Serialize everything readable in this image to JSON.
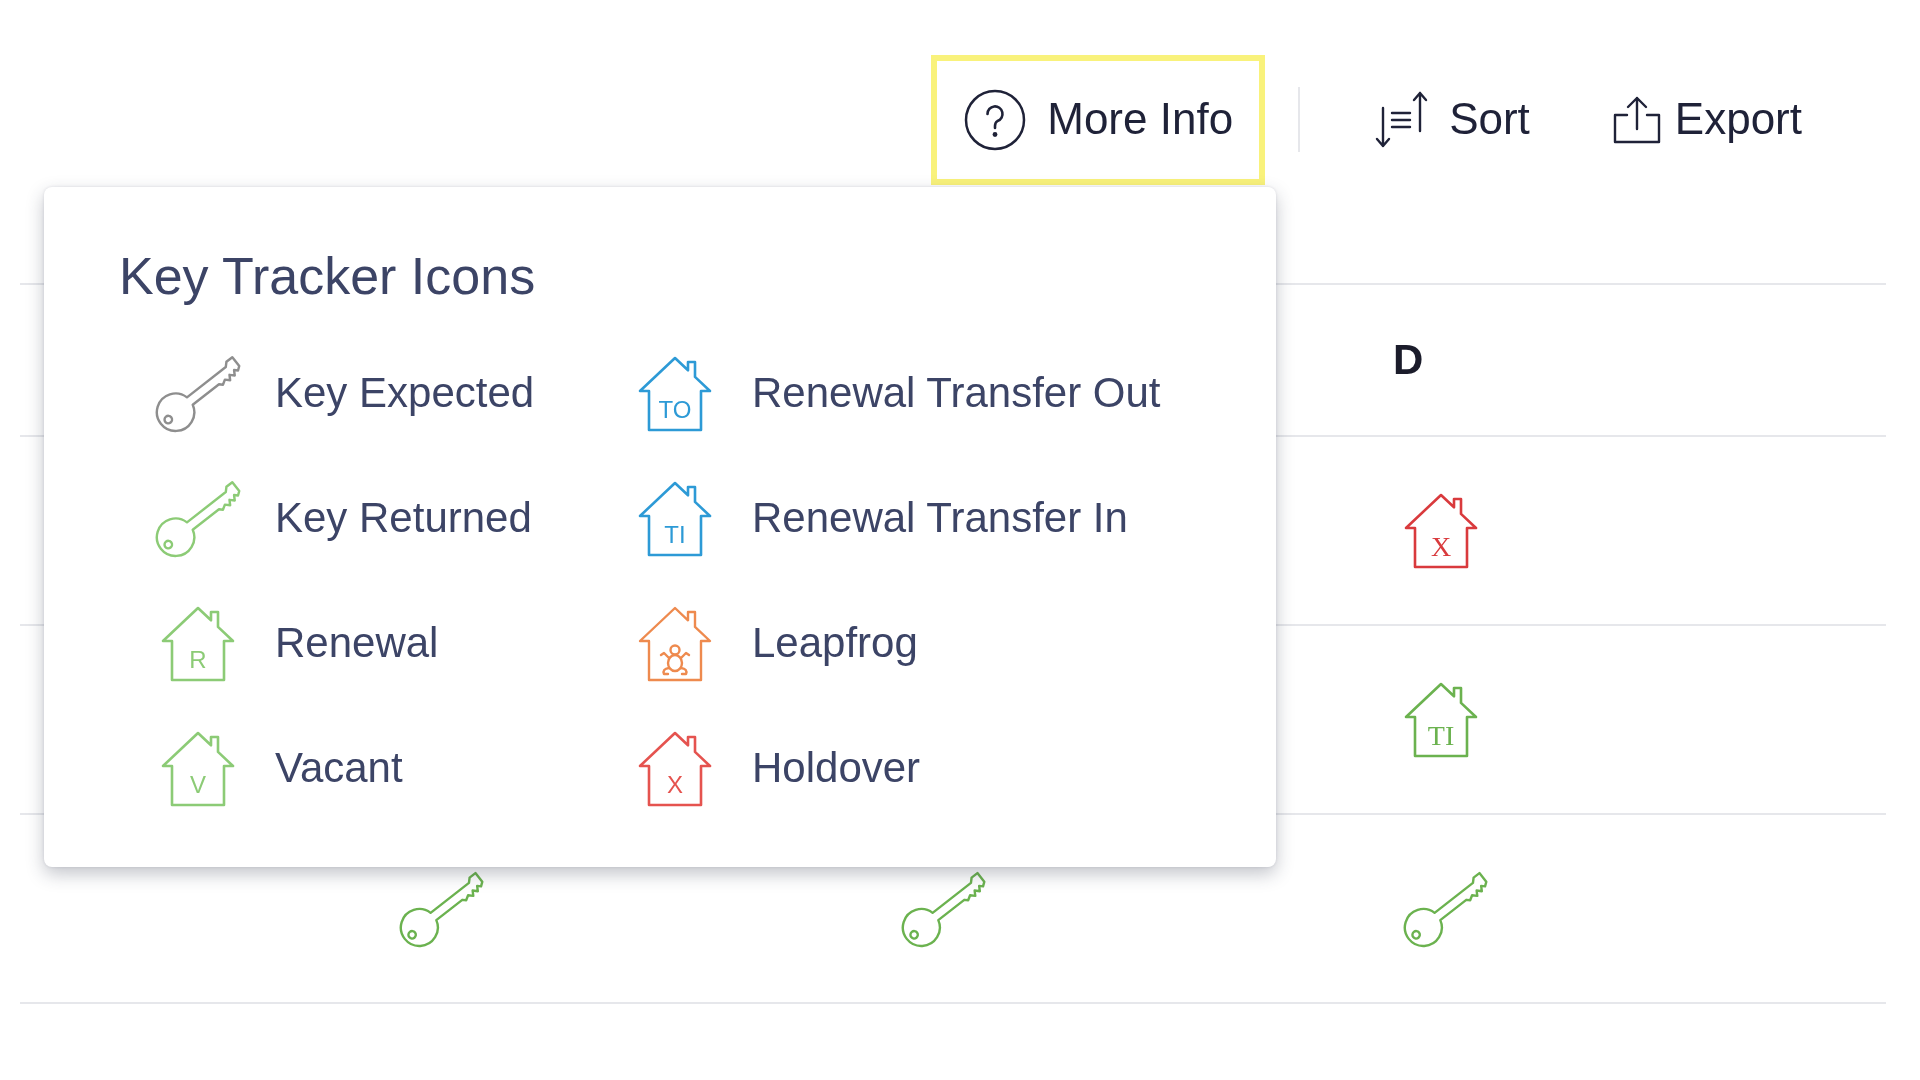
{
  "toolbar": {
    "buttons": [
      {
        "kind": "help",
        "label": "More Info",
        "highlighted": true
      },
      {
        "kind": "sort",
        "label": "Sort",
        "highlighted": false
      },
      {
        "kind": "export",
        "label": "Export",
        "highlighted": false
      }
    ]
  },
  "table": {
    "headings": {
      "column_4": "D"
    },
    "rows": [
      {
        "column_4": {
          "kind": "house",
          "letter": "X",
          "color": "#d93a3d"
        }
      },
      {
        "column_4": {
          "kind": "house",
          "letter": "TI",
          "color": "#6bb24f"
        }
      },
      {
        "column_2": {
          "kind": "key",
          "color": "#6bb24f"
        },
        "column_3": {
          "kind": "key",
          "color": "#6bb24f"
        },
        "column_4": {
          "kind": "key",
          "color": "#6bb24f"
        }
      }
    ]
  },
  "legend": {
    "title": "Key Tracker Icons",
    "items": [
      {
        "label": "Key Expected",
        "icon": {
          "kind": "key",
          "color": "#8e8e8e"
        }
      },
      {
        "label": "Renewal Transfer Out",
        "icon": {
          "kind": "house",
          "letter": "TO",
          "color": "#2d9ad6"
        }
      },
      {
        "label": "Key Returned",
        "icon": {
          "kind": "key",
          "color": "#8ccb76"
        }
      },
      {
        "label": "Renewal Transfer In",
        "icon": {
          "kind": "house",
          "letter": "TI",
          "color": "#2d9ad6"
        }
      },
      {
        "label": "Renewal",
        "icon": {
          "kind": "house",
          "letter": "R",
          "color": "#8ccb76"
        }
      },
      {
        "label": "Leapfrog",
        "icon": {
          "kind": "frog",
          "color": "#ee8a4e"
        }
      },
      {
        "label": "Vacant",
        "icon": {
          "kind": "house",
          "letter": "V",
          "color": "#8ccb76"
        }
      },
      {
        "label": "Holdover",
        "icon": {
          "kind": "house",
          "letter": "X",
          "color": "#e5534f"
        }
      }
    ]
  }
}
